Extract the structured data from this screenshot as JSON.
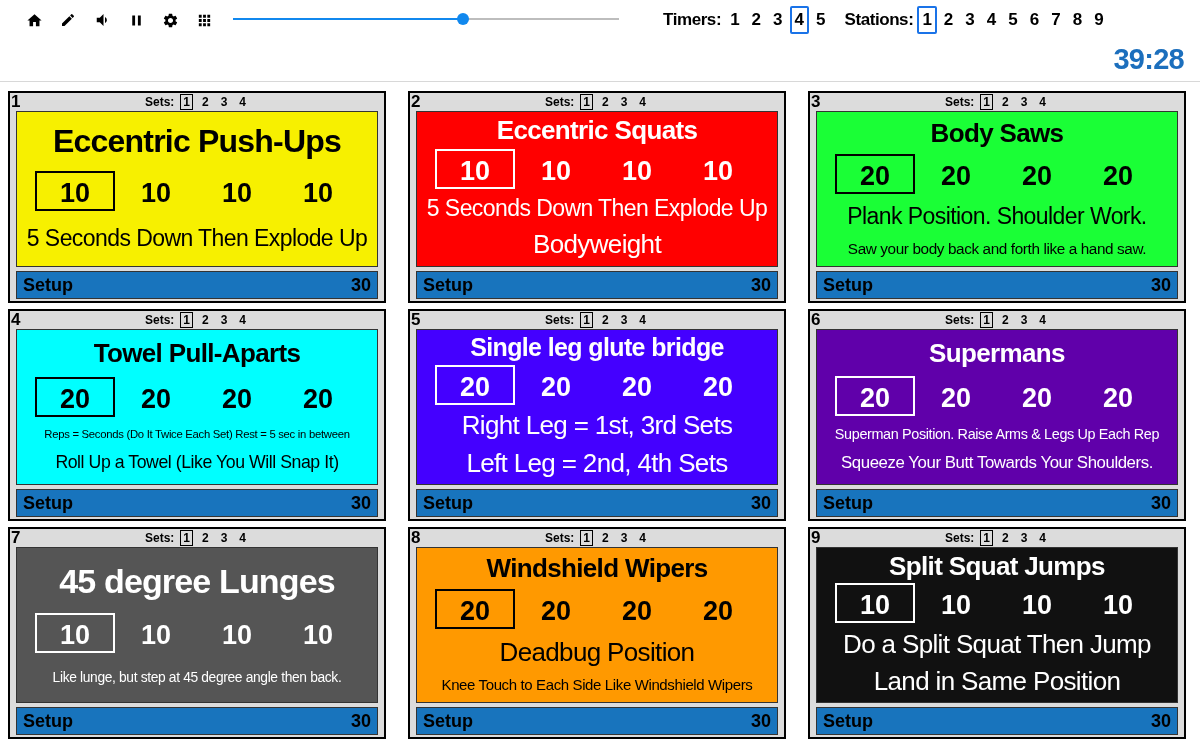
{
  "slider": {
    "level": 0.6
  },
  "timers": {
    "label": "Timers:",
    "items": [
      {
        "label": "1",
        "selected": false
      },
      {
        "label": "2",
        "selected": false
      },
      {
        "label": "3",
        "selected": false
      },
      {
        "label": "4",
        "selected": true
      },
      {
        "label": "5",
        "selected": false
      }
    ]
  },
  "station_picker": {
    "label": "Stations:",
    "items": [
      {
        "label": "1",
        "selected": true
      },
      {
        "label": "2",
        "selected": false
      },
      {
        "label": "3",
        "selected": false
      },
      {
        "label": "4",
        "selected": false
      },
      {
        "label": "5",
        "selected": false
      },
      {
        "label": "6",
        "selected": false
      },
      {
        "label": "7",
        "selected": false
      },
      {
        "label": "8",
        "selected": false
      },
      {
        "label": "9",
        "selected": false
      }
    ]
  },
  "clock": "39:28",
  "stations": [
    {
      "number": "1",
      "color": "#f7f000",
      "sets_label": "Sets:",
      "sets": [
        {
          "label": "1",
          "selected": true
        },
        {
          "label": "2",
          "selected": false
        },
        {
          "label": "3",
          "selected": false
        },
        {
          "label": "4",
          "selected": false
        }
      ],
      "title": "Eccentric Push-Ups",
      "reps": [
        {
          "value": "10",
          "selected": true
        },
        {
          "value": "10",
          "selected": false
        },
        {
          "value": "10",
          "selected": false
        },
        {
          "value": "10",
          "selected": false
        }
      ],
      "notes": [
        {
          "kind": "lead",
          "text": "5 Seconds Down Then Explode Up"
        }
      ],
      "setup": {
        "label": "Setup",
        "value": "30"
      }
    },
    {
      "number": "2",
      "color": "#ff0000",
      "sets_label": "Sets:",
      "sets": [
        {
          "label": "1",
          "selected": true
        },
        {
          "label": "2",
          "selected": false
        },
        {
          "label": "3",
          "selected": false
        },
        {
          "label": "4",
          "selected": false
        }
      ],
      "title": "Eccentric Squats",
      "reps": [
        {
          "value": "10",
          "selected": true
        },
        {
          "value": "10",
          "selected": false
        },
        {
          "value": "10",
          "selected": false
        },
        {
          "value": "10",
          "selected": false
        }
      ],
      "notes": [
        {
          "kind": "lead",
          "text": "5 Seconds Down Then Explode Up"
        },
        {
          "kind": "lead",
          "text": "Bodyweight"
        }
      ],
      "setup": {
        "label": "Setup",
        "value": "30"
      }
    },
    {
      "number": "3",
      "color": "#1aff36",
      "sets_label": "Sets:",
      "sets": [
        {
          "label": "1",
          "selected": true
        },
        {
          "label": "2",
          "selected": false
        },
        {
          "label": "3",
          "selected": false
        },
        {
          "label": "4",
          "selected": false
        }
      ],
      "title": "Body Saws",
      "reps": [
        {
          "value": "20",
          "selected": true
        },
        {
          "value": "20",
          "selected": false
        },
        {
          "value": "20",
          "selected": false
        },
        {
          "value": "20",
          "selected": false
        }
      ],
      "notes": [
        {
          "kind": "lead",
          "text": "Plank Position. Shoulder Work."
        },
        {
          "kind": "note",
          "text": "Saw your body back and forth like a hand saw."
        }
      ],
      "setup": {
        "label": "Setup",
        "value": "30"
      }
    },
    {
      "number": "4",
      "color": "#00ffff",
      "sets_label": "Sets:",
      "sets": [
        {
          "label": "1",
          "selected": true
        },
        {
          "label": "2",
          "selected": false
        },
        {
          "label": "3",
          "selected": false
        },
        {
          "label": "4",
          "selected": false
        }
      ],
      "title": "Towel Pull-Aparts",
      "reps": [
        {
          "value": "20",
          "selected": true
        },
        {
          "value": "20",
          "selected": false
        },
        {
          "value": "20",
          "selected": false
        },
        {
          "value": "20",
          "selected": false
        }
      ],
      "notes": [
        {
          "kind": "fine",
          "text": "Reps = Seconds (Do It Twice Each Set) Rest = 5 sec in between"
        },
        {
          "kind": "body",
          "text": "Roll Up a Towel (Like You Will Snap It)"
        }
      ],
      "setup": {
        "label": "Setup",
        "value": "30"
      }
    },
    {
      "number": "5",
      "color": "#4400ff",
      "sets_label": "Sets:",
      "sets": [
        {
          "label": "1",
          "selected": true
        },
        {
          "label": "2",
          "selected": false
        },
        {
          "label": "3",
          "selected": false
        },
        {
          "label": "4",
          "selected": false
        }
      ],
      "title": "Single leg glute bridge",
      "reps": [
        {
          "value": "20",
          "selected": true
        },
        {
          "value": "20",
          "selected": false
        },
        {
          "value": "20",
          "selected": false
        },
        {
          "value": "20",
          "selected": false
        }
      ],
      "notes": [
        {
          "kind": "lead",
          "text": "Right Leg = 1st, 3rd Sets"
        },
        {
          "kind": "lead",
          "text": "Left Leg = 2nd, 4th Sets"
        }
      ],
      "setup": {
        "label": "Setup",
        "value": "30"
      }
    },
    {
      "number": "6",
      "color": "#6000aa",
      "sets_label": "Sets:",
      "sets": [
        {
          "label": "1",
          "selected": true
        },
        {
          "label": "2",
          "selected": false
        },
        {
          "label": "3",
          "selected": false
        },
        {
          "label": "4",
          "selected": false
        }
      ],
      "title": "Supermans",
      "reps": [
        {
          "value": "20",
          "selected": true
        },
        {
          "value": "20",
          "selected": false
        },
        {
          "value": "20",
          "selected": false
        },
        {
          "value": "20",
          "selected": false
        }
      ],
      "notes": [
        {
          "kind": "note",
          "text": "Superman Position. Raise Arms & Legs Up Each Rep"
        },
        {
          "kind": "body",
          "text": "Squeeze Your Butt Towards Your Shoulders."
        }
      ],
      "setup": {
        "label": "Setup",
        "value": "30"
      }
    },
    {
      "number": "7",
      "color": "#555555",
      "sets_label": "Sets:",
      "sets": [
        {
          "label": "1",
          "selected": true
        },
        {
          "label": "2",
          "selected": false
        },
        {
          "label": "3",
          "selected": false
        },
        {
          "label": "4",
          "selected": false
        }
      ],
      "title": "45 degree Lunges",
      "reps": [
        {
          "value": "10",
          "selected": true
        },
        {
          "value": "10",
          "selected": false
        },
        {
          "value": "10",
          "selected": false
        },
        {
          "value": "10",
          "selected": false
        }
      ],
      "notes": [
        {
          "kind": "note",
          "text": "Like lunge, but step at 45 degree angle then back."
        }
      ],
      "setup": {
        "label": "Setup",
        "value": "30"
      }
    },
    {
      "number": "8",
      "color": "#ff9900",
      "sets_label": "Sets:",
      "sets": [
        {
          "label": "1",
          "selected": true
        },
        {
          "label": "2",
          "selected": false
        },
        {
          "label": "3",
          "selected": false
        },
        {
          "label": "4",
          "selected": false
        }
      ],
      "title": "Windshield Wipers",
      "reps": [
        {
          "value": "20",
          "selected": true
        },
        {
          "value": "20",
          "selected": false
        },
        {
          "value": "20",
          "selected": false
        },
        {
          "value": "20",
          "selected": false
        }
      ],
      "notes": [
        {
          "kind": "lead",
          "text": "Deadbug Position"
        },
        {
          "kind": "note",
          "text": "Knee Touch to Each Side Like Windshield Wipers"
        }
      ],
      "setup": {
        "label": "Setup",
        "value": "30"
      }
    },
    {
      "number": "9",
      "color": "#111111",
      "sets_label": "Sets:",
      "sets": [
        {
          "label": "1",
          "selected": true
        },
        {
          "label": "2",
          "selected": false
        },
        {
          "label": "3",
          "selected": false
        },
        {
          "label": "4",
          "selected": false
        }
      ],
      "title": "Split Squat Jumps",
      "reps": [
        {
          "value": "10",
          "selected": true
        },
        {
          "value": "10",
          "selected": false
        },
        {
          "value": "10",
          "selected": false
        },
        {
          "value": "10",
          "selected": false
        }
      ],
      "notes": [
        {
          "kind": "lead",
          "text": "Do a Split Squat Then Jump"
        },
        {
          "kind": "lead",
          "text": "Land in Same Position"
        }
      ],
      "setup": {
        "label": "Setup",
        "value": "30"
      }
    }
  ]
}
